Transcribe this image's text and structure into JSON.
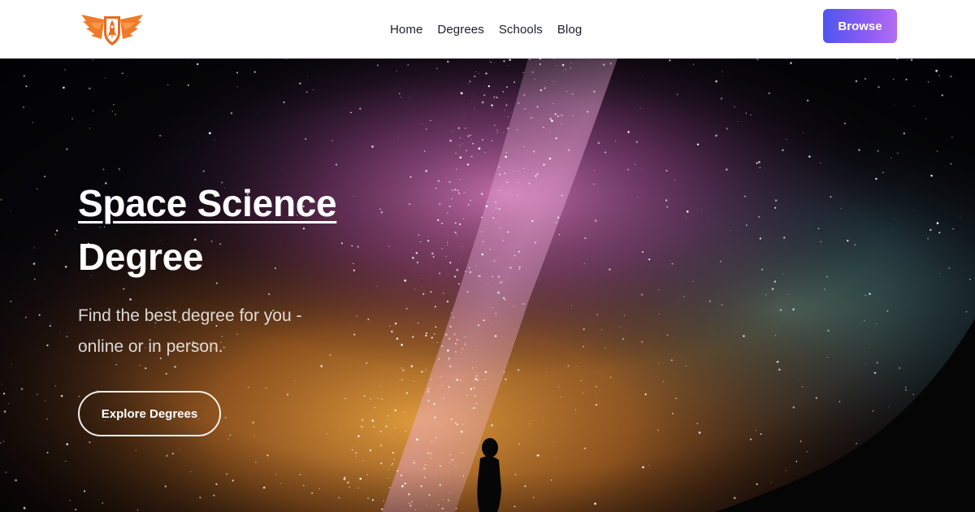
{
  "header": {
    "logo_icon": "winged-shield-rocket-logo",
    "nav": [
      {
        "label": "Home"
      },
      {
        "label": "Degrees"
      },
      {
        "label": "Schools"
      },
      {
        "label": "Blog"
      }
    ],
    "browse_label": "Browse"
  },
  "hero": {
    "title_line1": "Space Science",
    "title_line2": "Degree",
    "subtitle": "Find the best degree for you - online or in person.",
    "cta_label": "Explore Degrees",
    "background": "milky-way-night-sky-with-silhouette"
  },
  "colors": {
    "logo_orange": "#ef7a2a",
    "button_gradient_start": "#4f56f0",
    "button_gradient_end": "#b26ef0",
    "nav_text": "#1d1d2c"
  }
}
